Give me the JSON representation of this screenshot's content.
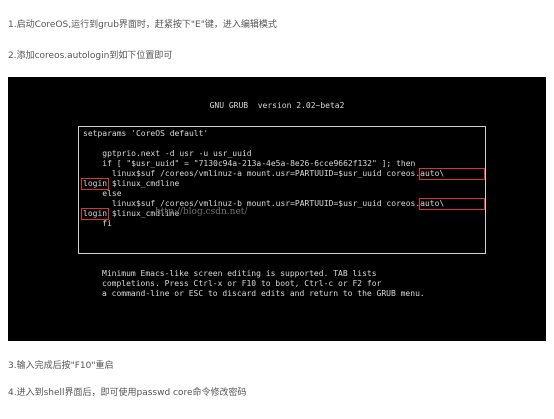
{
  "steps": {
    "step1": "1.启动CoreOS,运行到grub界面时，赶紧按下\"E\"键，进入编辑模式",
    "step2": "2.添加coreos.autologin到如下位置即可",
    "step3": "3.输入完成后按\"F10\"重启",
    "step4": "4.进入到shell界面后，即可使用passwd core命令修改密码"
  },
  "terminal": {
    "title": "GNU GRUB  version 2.02~beta2",
    "lines": [
      "setparams 'CoreOS default'",
      "",
      "    gptprio.next -d usr -u usr_uuid",
      "    if [ \"$usr_uuid\" = \"7130c94a-213a-4e5a-8e26-6cce9662f132\" ]; then",
      "      linux$suf /coreos/vmlinuz-a mount.usr=PARTUUID=$usr_uuid coreos.auto\\",
      "login $linux_cmdline",
      "    else",
      "      linux$suf /coreos/vmlinuz-b mount.usr=PARTUUID=$usr_uuid coreos.auto\\",
      "login $linux_cmdline",
      "    fi"
    ],
    "watermark": "http://blog.csdn.net/",
    "help": [
      "Minimum Emacs-like screen editing is supported. TAB lists",
      "completions. Press Ctrl-x or F10 to boot, Ctrl-c or F2 for",
      "a command-line or ESC to discard edits and return to the GRUB menu."
    ]
  },
  "colors": {
    "terminal_bg": "#000000",
    "terminal_text": "#d8d8d8",
    "highlight": "#e0302a"
  }
}
